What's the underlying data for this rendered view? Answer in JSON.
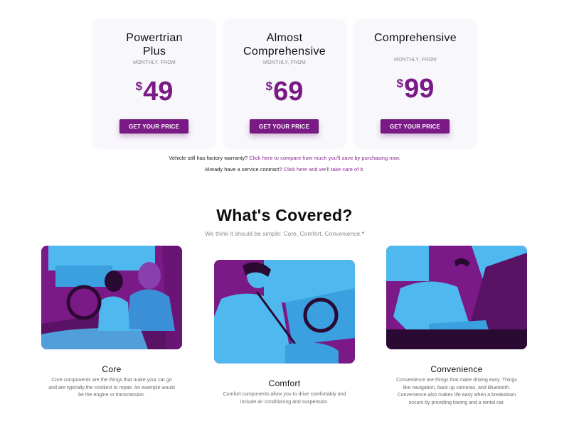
{
  "plans": [
    {
      "name_line1": "Powertrian",
      "name_line2": "Plus",
      "subtitle": "MONTHLY, FROM",
      "currency": "$",
      "price": "49",
      "button": "GET YOUR PRICE"
    },
    {
      "name_line1": "Almost",
      "name_line2": "Comprehensive",
      "subtitle": "MONTHLY, FROM",
      "currency": "$",
      "price": "69",
      "button": "GET YOUR PRICE"
    },
    {
      "name_line1": "Comprehensive",
      "name_line2": "",
      "subtitle": "MONTHLY, FROM",
      "currency": "$",
      "price": "99",
      "button": "GET YOUR PRICE"
    }
  ],
  "notes": {
    "warranty_text": "Vehicle still has factory warranty?",
    "warranty_link": "Click here to compare how much you'll save by purchasing now.",
    "contract_text": "Already have a service contract?",
    "contract_link": "Click here and we'll take care of it."
  },
  "covered": {
    "title": "What's Covered?",
    "subtitle": "We think it should be simple: Core, Comfort, Convenience.",
    "subtitle_mark": "*",
    "cards": [
      {
        "title": "Core",
        "text": "Core components are the things that make your car go and are typically the costliest to repair. An example would be the engine or transmission."
      },
      {
        "title": "Comfort",
        "text": "Comfort components allow you to drive comfortably and include air conditioning and suspension."
      },
      {
        "title": "Convenience",
        "text": "Convenience are things that make driving easy. Things like navigation, back up cameras, and Bluetooth. Convenience also makes life easy when a breakdown occurs by providing towing and a rental car."
      }
    ]
  },
  "colors": {
    "accent": "#7b1a86",
    "photo_highlight": "#4fb8ee",
    "card_bg": "#f8f7fc"
  }
}
